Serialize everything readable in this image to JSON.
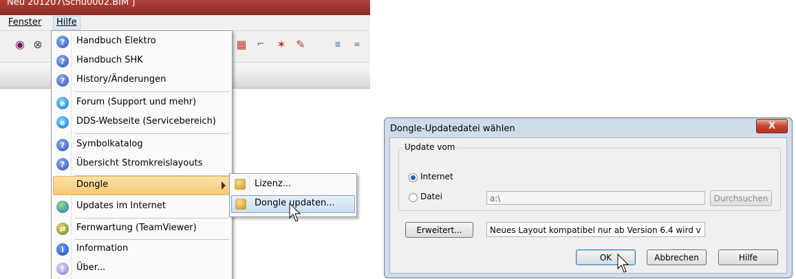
{
  "window_title": "Neu 201207\\Schu0002.BIM ]",
  "menubar": {
    "fenster": "Fenster",
    "hilfe": "Hilfe"
  },
  "menu": {
    "items": [
      {
        "label": "Handbuch Elektro",
        "icon": "help-icon"
      },
      {
        "label": "Handbuch SHK",
        "icon": "help-icon"
      },
      {
        "label": "History/Änderungen",
        "icon": "help-icon"
      },
      {
        "label": "Forum (Support und mehr)",
        "icon": "globe-web-icon"
      },
      {
        "label": "DDS-Webseite (Servicebereich)",
        "icon": "globe-web-icon"
      },
      {
        "label": "Symbolkatalog",
        "icon": "help-icon"
      },
      {
        "label": "Übersicht Stromkreislayouts",
        "icon": "help-icon"
      },
      {
        "label": "Dongle",
        "icon": ""
      },
      {
        "label": "Updates im Internet",
        "icon": "earth-icon"
      },
      {
        "label": "Fernwartung (TeamViewer)",
        "icon": "teamviewer-icon"
      },
      {
        "label": "Information",
        "icon": "info-icon"
      },
      {
        "label": "Über...",
        "icon": "about-icon"
      }
    ]
  },
  "submenu": {
    "items": [
      {
        "label": "Lizenz...",
        "icon": "license-icon"
      },
      {
        "label": "Dongle updaten...",
        "icon": "dongle-update-icon"
      }
    ]
  },
  "dialog": {
    "title": "Dongle-Updatedatei wählen",
    "close_glyph": "X",
    "group_label": "Update vom",
    "radio_internet": "Internet",
    "radio_datei": "Datei",
    "path_value": "a:\\",
    "browse_button": "Durchsuchen",
    "advanced_button": "Erweitert...",
    "info_text": "Neues Layout kompatibel nur ab Version 6.4 wird v",
    "ok_button": "OK",
    "cancel_button": "Abbrechen",
    "help_button": "Hilfe",
    "selected_source": "Internet"
  },
  "colors": {
    "menu_highlight": "#f7c876",
    "submenu_highlight": "#c9def5",
    "dialog_frame": "#cfdcec",
    "titlebar": "#8d2a25"
  }
}
